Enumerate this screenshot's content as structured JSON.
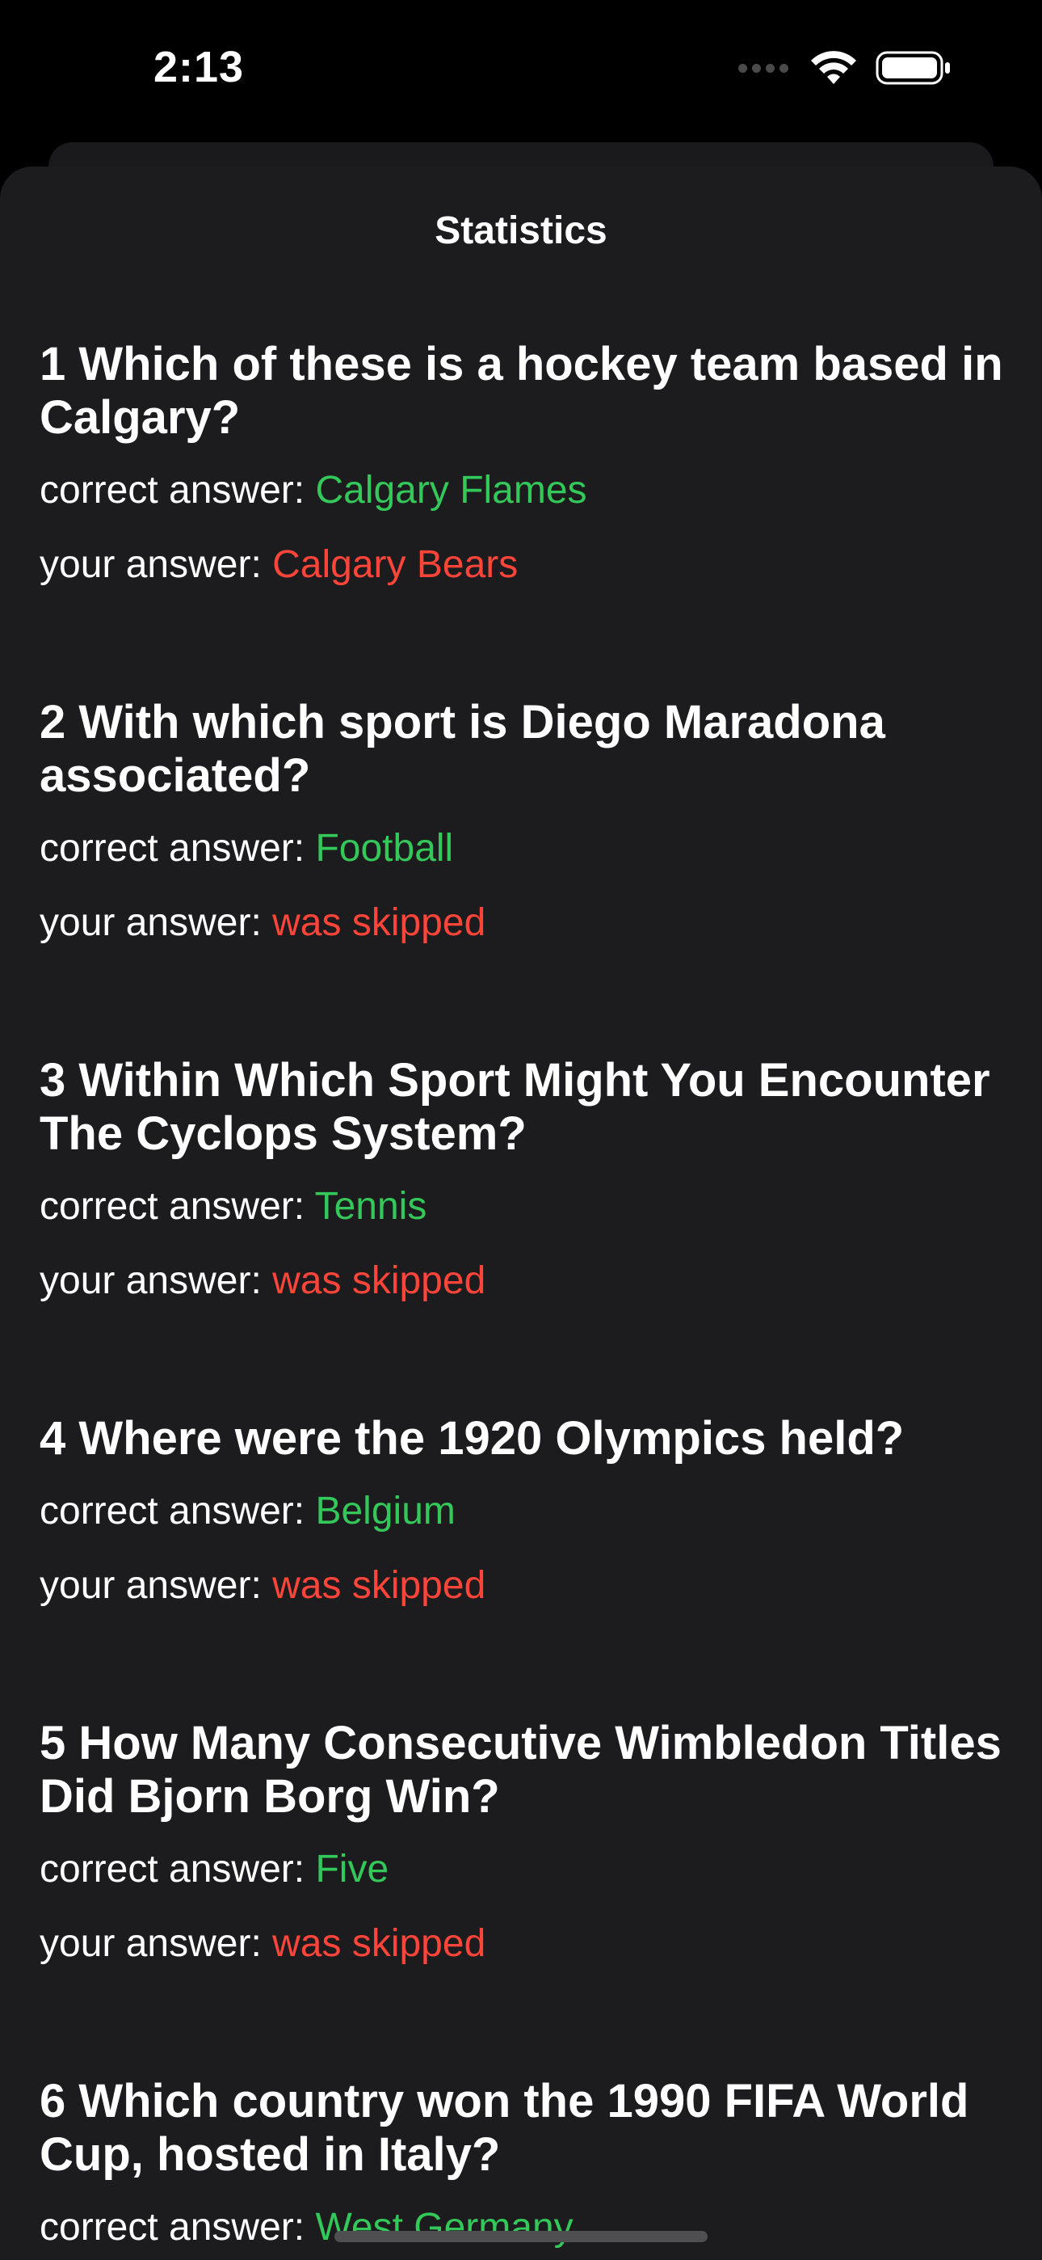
{
  "status_bar": {
    "time": "2:13",
    "icons": [
      "cellular-signal-icon",
      "wifi-icon",
      "battery-icon"
    ]
  },
  "sheet": {
    "title": "Statistics"
  },
  "labels": {
    "correct_prefix": "correct answer:",
    "yours_prefix": "your answer:"
  },
  "colors": {
    "correct": "#34c759",
    "wrong": "#ff453a",
    "background": "#1c1c1e"
  },
  "questions": [
    {
      "number": "1",
      "question": "Which of these is a hockey team based in Calgary?",
      "correct_answer": "Calgary Flames",
      "your_answer": "Calgary Bears"
    },
    {
      "number": "2",
      "question": "With which sport is Diego Maradona associated?",
      "correct_answer": "Football",
      "your_answer": "was skipped"
    },
    {
      "number": "3",
      "question": "Within Which Sport Might You Encounter The Cyclops System?",
      "correct_answer": "Tennis",
      "your_answer": "was skipped"
    },
    {
      "number": "4",
      "question": "Where were the 1920 Olympics held?",
      "correct_answer": "Belgium",
      "your_answer": "was skipped"
    },
    {
      "number": "5",
      "question": "How Many Consecutive Wimbledon Titles Did Bjorn Borg Win?",
      "correct_answer": "Five",
      "your_answer": "was skipped"
    },
    {
      "number": "6",
      "question": "Which country won the 1990 FIFA World Cup, hosted in Italy?",
      "correct_answer": "West Germany",
      "your_answer": ""
    }
  ]
}
